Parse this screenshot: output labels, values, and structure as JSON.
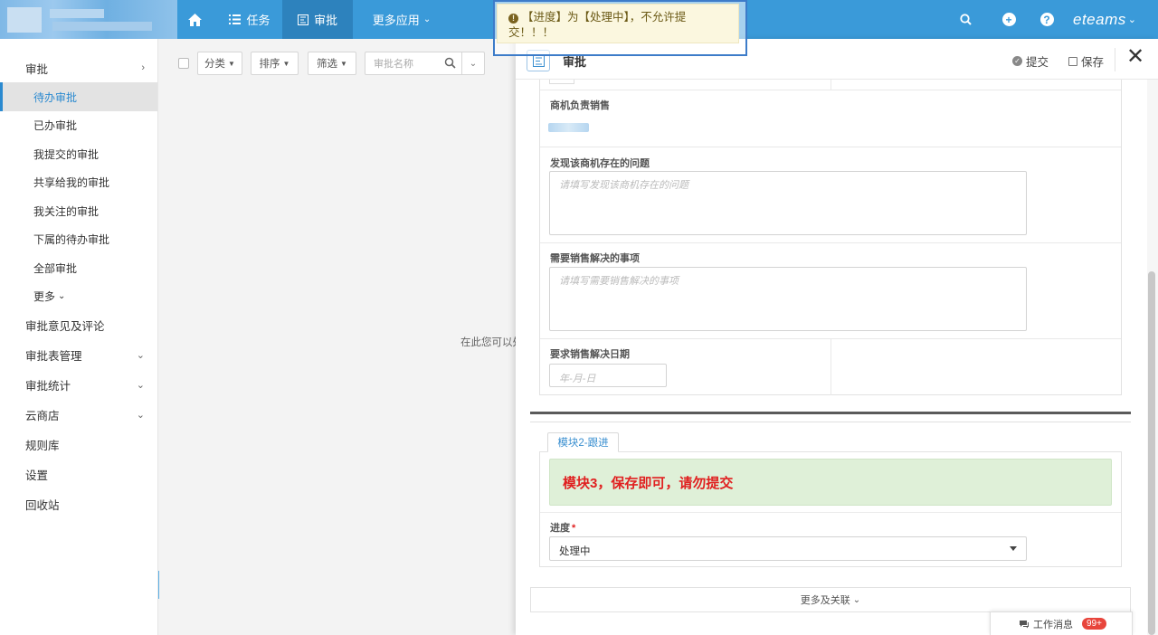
{
  "topbar": {
    "nav": {
      "task": "任务",
      "approval": "审批",
      "more_apps": "更多应用"
    },
    "brand": "eteams"
  },
  "toast": {
    "message": "【进度】为【处理中】，不允许提交！！！"
  },
  "sidebar": {
    "approval_header": "审批",
    "items": [
      {
        "label": "待办审批",
        "active": true
      },
      {
        "label": "已办审批"
      },
      {
        "label": "我提交的审批"
      },
      {
        "label": "共享给我的审批"
      },
      {
        "label": "我关注的审批"
      },
      {
        "label": "下属的待办审批"
      },
      {
        "label": "全部审批"
      },
      {
        "label": "更多"
      }
    ],
    "sections": [
      {
        "label": "审批意见及评论"
      },
      {
        "label": "审批表管理"
      },
      {
        "label": "审批统计"
      },
      {
        "label": "云商店"
      },
      {
        "label": "规则库"
      },
      {
        "label": "设置"
      },
      {
        "label": "回收站"
      }
    ]
  },
  "list_toolbar": {
    "category": "分类",
    "sort": "排序",
    "filter": "筛选",
    "search_placeholder": "审批名称"
  },
  "list_empty_hint": "在此您可以处",
  "panel": {
    "title": "审批",
    "submit": "提交",
    "save": "保存",
    "fields": {
      "owner_label": "商机负责销售",
      "problem_label": "发现该商机存在的问题",
      "problem_placeholder": "请填写发现该商机存在的问题",
      "matters_label": "需要销售解决的事项",
      "matters_placeholder": "请填写需要销售解决的事项",
      "date_label": "要求销售解决日期",
      "date_placeholder": "年-月-日"
    },
    "module": {
      "tab_label": "模块2-跟进",
      "notice": "模块3，保存即可，请勿提交",
      "progress_label": "进度",
      "progress_value": "处理中"
    },
    "more_related": "更多及关联"
  },
  "work_messages": {
    "label": "工作消息",
    "badge": "99+"
  },
  "colors": {
    "topbar": "#3a9ad9",
    "active_nav": "#2d82bd",
    "accent": "#2b8ad0",
    "notice_text": "#e02020",
    "notice_bg": "#dff0d8"
  }
}
